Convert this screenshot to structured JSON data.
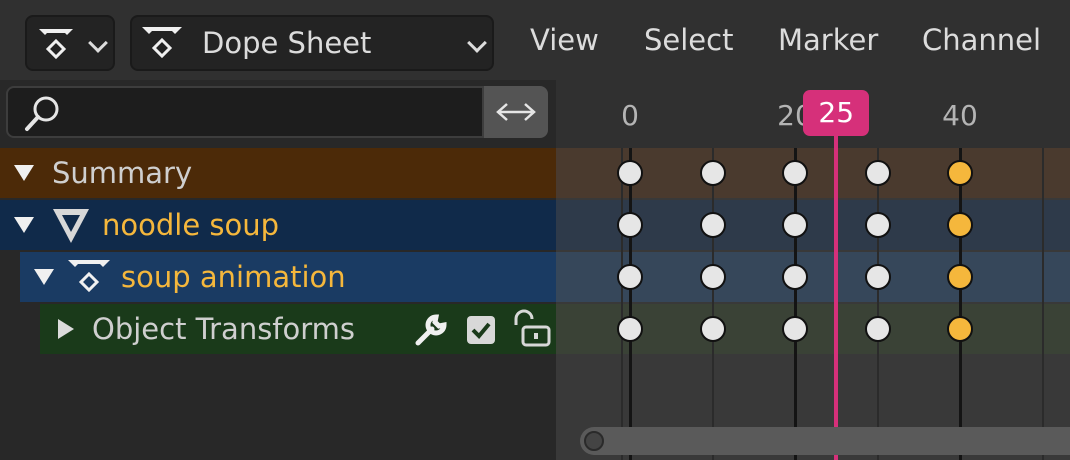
{
  "header": {
    "editor_type_icon": "action-icon",
    "mode_label": "Dope Sheet",
    "menus": [
      "View",
      "Select",
      "Marker",
      "Channel"
    ]
  },
  "search": {
    "value": "",
    "placeholder": ""
  },
  "channels": [
    {
      "label": "Summary",
      "expanded": true,
      "bg": "#4c2a08",
      "text_color": "#cfcfcf"
    },
    {
      "label": "noodle soup",
      "expanded": true,
      "icon": "mesh-cone-icon",
      "bg": "#102a4a",
      "text_color": "#f5b73c"
    },
    {
      "label": "soup animation",
      "expanded": true,
      "icon": "action-icon",
      "bg": "#1a3b63",
      "text_color": "#f5b73c"
    },
    {
      "label": "Object Transforms",
      "expanded": false,
      "bg": "#1a3a1a",
      "text_color": "#cfcfcf",
      "icons": [
        "wrench-icon",
        "checkbox-icon",
        "unlock-icon"
      ]
    }
  ],
  "timeline": {
    "ruler_labels": [
      {
        "label": "0",
        "frame": 0
      },
      {
        "label": "20",
        "frame": 20
      },
      {
        "label": "40",
        "frame": 40
      }
    ],
    "current_frame": "25",
    "keyframes": [
      0,
      10,
      20,
      30,
      40
    ],
    "selected_keyframes": [
      40
    ],
    "row_backgrounds": [
      "#4a3a2e",
      "#2e3a4a",
      "#36475a",
      "#3a4236"
    ],
    "colors": {
      "key_normal": "#e6e6e6",
      "key_selected": "#f5b73c",
      "playhead": "#d6307a"
    }
  }
}
